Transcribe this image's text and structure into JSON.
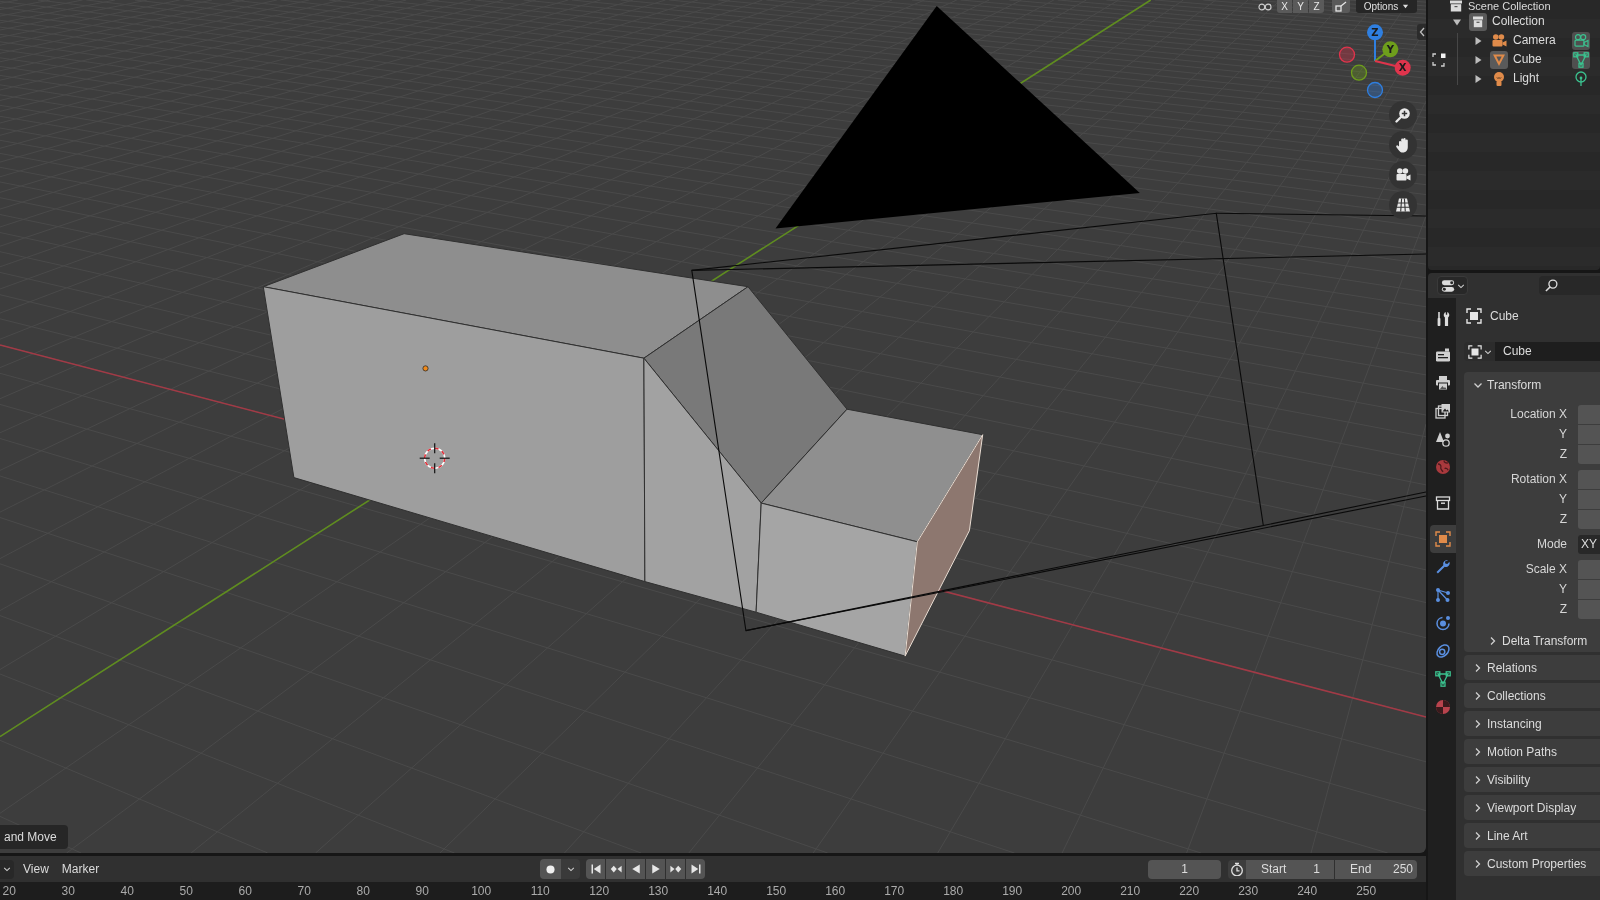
{
  "viewport": {
    "header": {
      "axis_toggles": [
        "X",
        "Y",
        "Z"
      ],
      "options": "Options"
    },
    "gizmo": [
      {
        "kind": "z",
        "label": "Z",
        "color": "#2f7fe0"
      },
      {
        "kind": "y",
        "label": "Y",
        "color": "#6e9e1c"
      },
      {
        "kind": "x",
        "label": "X",
        "color": "#e0344c"
      }
    ],
    "redo_panel": "and Move"
  },
  "outliner": {
    "root": "Scene Collection",
    "items": [
      {
        "label": "Collection",
        "kind": "collection",
        "expanded": true,
        "highlighted": true,
        "children": [
          {
            "label": "Camera",
            "kind": "camera",
            "expanded": false,
            "highlighted": false,
            "data_highlighted": true,
            "edit_mode": false
          },
          {
            "label": "Cube",
            "kind": "mesh",
            "expanded": false,
            "highlighted": true,
            "data_highlighted": true,
            "edit_mode": true
          },
          {
            "label": "Light",
            "kind": "light",
            "expanded": false,
            "highlighted": false,
            "data_highlighted": false,
            "edit_mode": false
          }
        ]
      }
    ]
  },
  "properties": {
    "tabs": [
      {
        "kind": "tool",
        "selected": false
      },
      {
        "kind": "render",
        "selected": false
      },
      {
        "kind": "output",
        "selected": false
      },
      {
        "kind": "view_layer",
        "selected": false
      },
      {
        "kind": "scene",
        "selected": false
      },
      {
        "kind": "world",
        "selected": false
      },
      {
        "kind": "collection",
        "selected": false
      },
      {
        "kind": "object",
        "selected": true
      },
      {
        "kind": "modifiers",
        "selected": false
      },
      {
        "kind": "particles",
        "selected": false
      },
      {
        "kind": "physics",
        "selected": false
      },
      {
        "kind": "constraints",
        "selected": false
      },
      {
        "kind": "data",
        "selected": false
      },
      {
        "kind": "material",
        "selected": false
      }
    ],
    "object_name": "Cube",
    "datablock_name": "Cube",
    "panels": [
      {
        "title": "Transform",
        "expanded": true,
        "groups": [
          [
            {
              "label": "Location X",
              "kind": "number"
            },
            {
              "label": "Y",
              "kind": "number"
            },
            {
              "label": "Z",
              "kind": "number"
            }
          ],
          [
            {
              "label": "Rotation X",
              "kind": "number"
            },
            {
              "label": "Y",
              "kind": "number"
            },
            {
              "label": "Z",
              "kind": "number"
            }
          ],
          [
            {
              "label": "Mode",
              "kind": "dropdown",
              "value": "XY"
            }
          ],
          [
            {
              "label": "Scale X",
              "kind": "number"
            },
            {
              "label": "Y",
              "kind": "number"
            },
            {
              "label": "Z",
              "kind": "number"
            }
          ]
        ],
        "subpanels": [
          {
            "title": "Delta Transform",
            "expanded": false
          }
        ]
      },
      {
        "title": "Relations",
        "expanded": false
      },
      {
        "title": "Collections",
        "expanded": false
      },
      {
        "title": "Instancing",
        "expanded": false
      },
      {
        "title": "Motion Paths",
        "expanded": false
      },
      {
        "title": "Visibility",
        "expanded": false
      },
      {
        "title": "Viewport Display",
        "expanded": false
      },
      {
        "title": "Line Art",
        "expanded": false
      },
      {
        "title": "Custom Properties",
        "expanded": false
      }
    ]
  },
  "timeline": {
    "menus": [
      "View",
      "Marker"
    ],
    "current_frame": "1",
    "start": {
      "label": "Start",
      "value": "1"
    },
    "end": {
      "label": "End",
      "value": "250"
    },
    "ruler": [
      "20",
      "30",
      "40",
      "50",
      "60",
      "70",
      "80",
      "90",
      "100",
      "110",
      "120",
      "130",
      "140",
      "150",
      "160",
      "170",
      "180",
      "190",
      "200",
      "210",
      "220",
      "230",
      "240",
      "250"
    ]
  }
}
